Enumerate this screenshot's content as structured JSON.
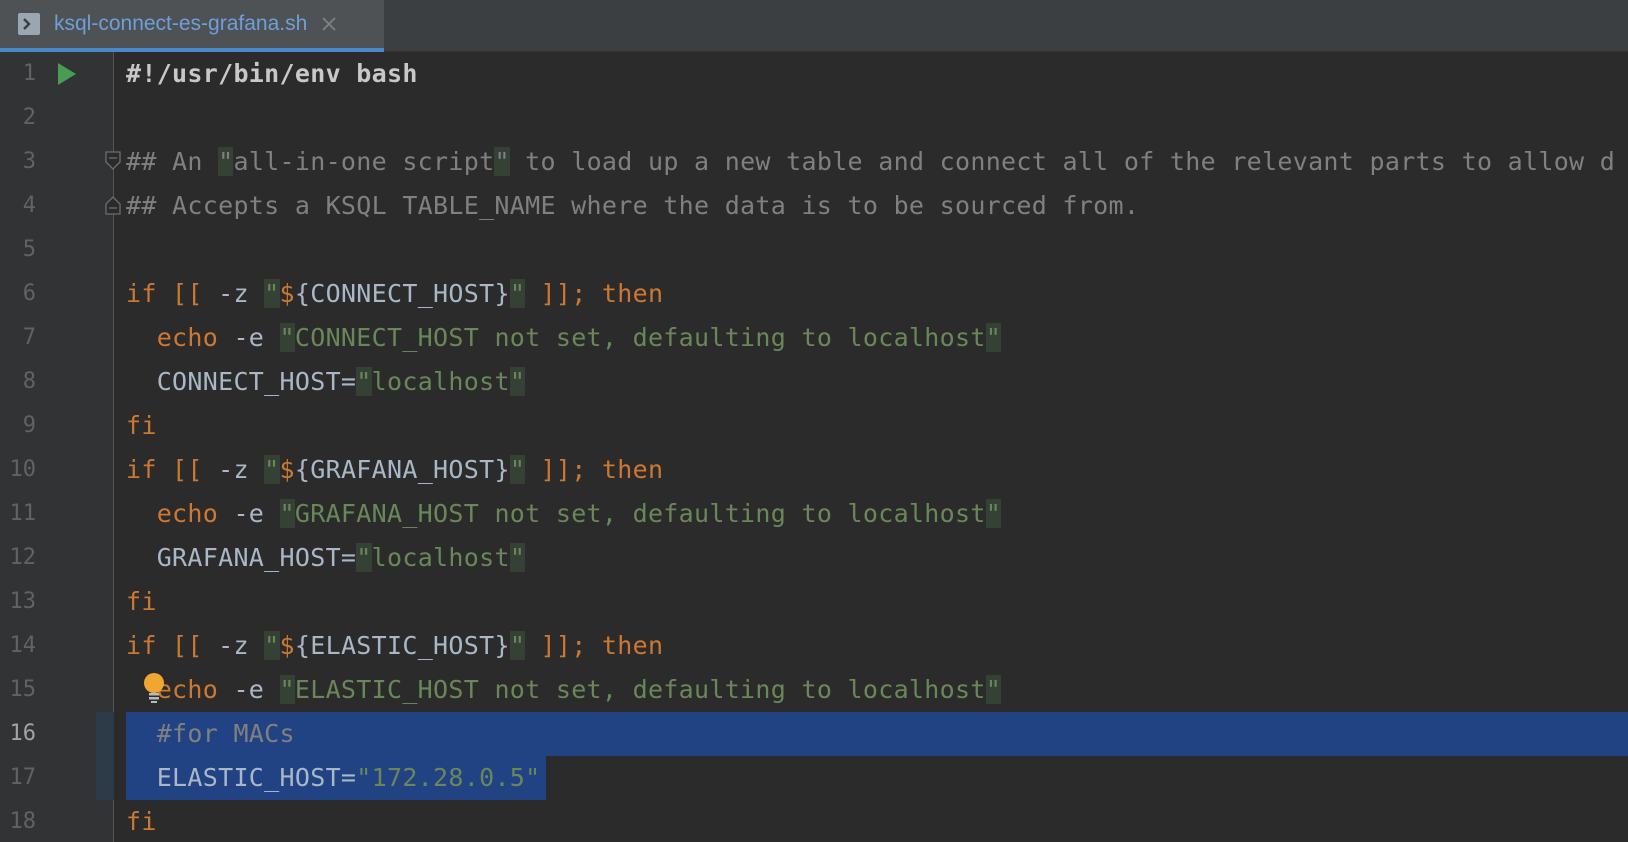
{
  "tab": {
    "title": "ksql-connect-es-grafana.sh",
    "icon": "terminal-script-icon"
  },
  "editor": {
    "current_line": 16,
    "lines": [
      {
        "num": "1",
        "code": "#!/usr/bin/env bash"
      },
      {
        "num": "2",
        "code": ""
      },
      {
        "num": "3",
        "code": "## An \"all-in-one script\" to load up a new table and connect all of the relevant parts to allow d"
      },
      {
        "num": "4",
        "code": "## Accepts a KSQL TABLE_NAME where the data is to be sourced from."
      },
      {
        "num": "5",
        "code": ""
      },
      {
        "num": "6",
        "code": "if [[ -z \"${CONNECT_HOST}\" ]]; then"
      },
      {
        "num": "7",
        "code": "  echo -e \"CONNECT_HOST not set, defaulting to localhost\""
      },
      {
        "num": "8",
        "code": "  CONNECT_HOST=\"localhost\""
      },
      {
        "num": "9",
        "code": "fi"
      },
      {
        "num": "10",
        "code": "if [[ -z \"${GRAFANA_HOST}\" ]]; then"
      },
      {
        "num": "11",
        "code": "  echo -e \"GRAFANA_HOST not set, defaulting to localhost\""
      },
      {
        "num": "12",
        "code": "  GRAFANA_HOST=\"localhost\""
      },
      {
        "num": "13",
        "code": "fi"
      },
      {
        "num": "14",
        "code": "if [[ -z \"${ELASTIC_HOST}\" ]]; then"
      },
      {
        "num": "15",
        "code": "  echo -e \"ELASTIC_HOST not set, defaulting to localhost\""
      },
      {
        "num": "16",
        "code": "  #for MACs"
      },
      {
        "num": "17",
        "code": "  ELASTIC_HOST=\"172.28.0.5\""
      },
      {
        "num": "18",
        "code": "fi"
      }
    ]
  },
  "colors": {
    "keyword": "#cc7832",
    "string": "#6a8759",
    "comment": "#808080",
    "selection": "#214283",
    "tab_underline": "#4a88c7"
  },
  "icons": {
    "run": "run-gutter-icon",
    "fold": "fold-marker-icon",
    "intention": "lightbulb-icon",
    "close": "close-icon"
  }
}
